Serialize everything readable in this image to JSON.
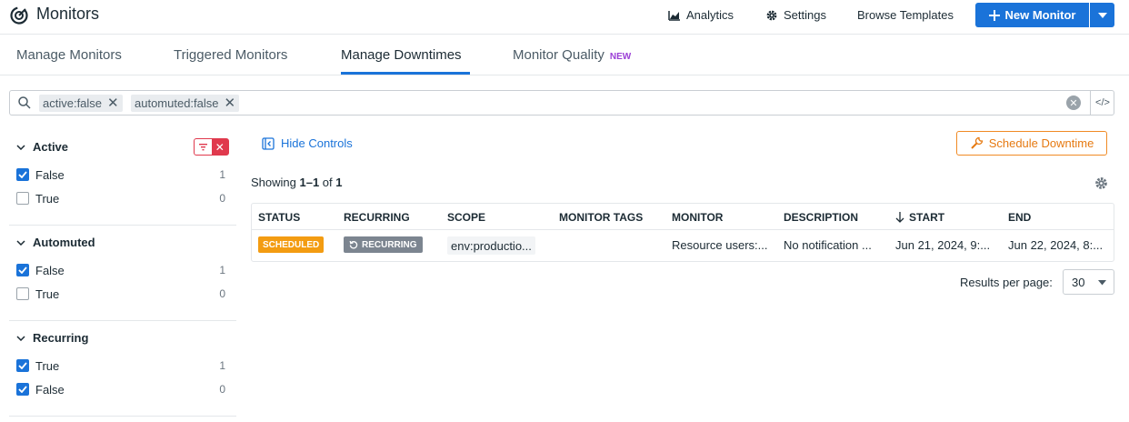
{
  "header": {
    "title": "Monitors",
    "analytics_label": "Analytics",
    "settings_label": "Settings",
    "browse_templates_label": "Browse Templates",
    "new_monitor_label": "New Monitor"
  },
  "tabs": [
    {
      "label": "Manage Monitors",
      "active": false
    },
    {
      "label": "Triggered Monitors",
      "active": false
    },
    {
      "label": "Manage Downtimes",
      "active": true
    },
    {
      "label": "Monitor Quality",
      "badge": "NEW",
      "active": false
    }
  ],
  "search": {
    "chips": [
      "active:false",
      "automuted:false"
    ]
  },
  "facets": [
    {
      "title": "Active",
      "options": [
        {
          "label": "False",
          "count": "1",
          "checked": true
        },
        {
          "label": "True",
          "count": "0",
          "checked": false
        }
      ]
    },
    {
      "title": "Automuted",
      "options": [
        {
          "label": "False",
          "count": "1",
          "checked": true
        },
        {
          "label": "True",
          "count": "0",
          "checked": false
        }
      ]
    },
    {
      "title": "Recurring",
      "options": [
        {
          "label": "True",
          "count": "1",
          "checked": true
        },
        {
          "label": "False",
          "count": "0",
          "checked": true
        }
      ]
    }
  ],
  "main": {
    "hide_controls_label": "Hide Controls",
    "schedule_downtime_label": "Schedule Downtime",
    "showing_prefix": "Showing ",
    "showing_range": "1–1",
    "showing_of": " of ",
    "showing_total": "1"
  },
  "table": {
    "columns": [
      "STATUS",
      "RECURRING",
      "SCOPE",
      "MONITOR TAGS",
      "MONITOR",
      "DESCRIPTION",
      "START",
      "END"
    ],
    "rows": [
      {
        "status": "SCHEDULED",
        "recurring": "RECURRING",
        "scope": "env:productio...",
        "monitor_tags": "",
        "monitor": "Resource users:...",
        "description": "No notification ...",
        "start": "Jun 21, 2024, 9:...",
        "end": "Jun 22, 2024, 8:..."
      }
    ]
  },
  "pagination": {
    "results_per_page_label": "Results per page:",
    "results_per_page_value": "30"
  },
  "colors": {
    "primary": "#1a73d9",
    "scheduled": "#f39c12",
    "schedule_button": "#f08a24",
    "danger": "#e0394d",
    "new_badge": "#9b3fd6"
  }
}
